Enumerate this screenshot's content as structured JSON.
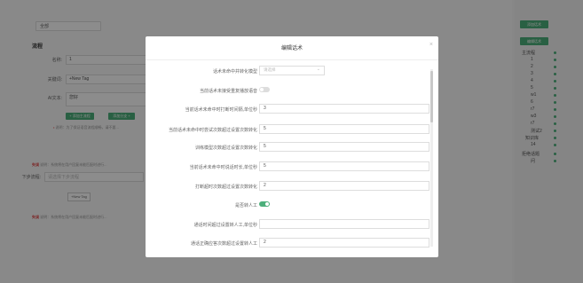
{
  "background": {
    "top_select": "全部",
    "section_flow": "流程",
    "fields": [
      {
        "label": "名称:",
        "value": "1"
      },
      {
        "label": "关键词:",
        "value": "+New Tag"
      },
      {
        "label": "AI文本:",
        "value": "您好"
      }
    ],
    "btn_add_main": "+ 添加主流程",
    "btn_add_branch": "添加分支 +",
    "note1_prefix": "• ",
    "note1": "说明：为了保证语音流程顺畅，请不要...",
    "section_hint": "失误",
    "hint_text": "说明：系统将在用户回复未能匹配时进行...",
    "next_label": "下步流程:",
    "next_placeholder": "请选择下步流程",
    "tag_new": "+New Tag",
    "section_hint2": "失误",
    "hint_text2": "说明：系统将在用户回复未能匹配时进行..."
  },
  "right_panel": {
    "btn_add": "添加话术",
    "btn_edit": "编辑话术",
    "tree": [
      "主流程",
      "1",
      "2",
      "3",
      "4",
      "5",
      "w1",
      "6",
      "r7",
      "w3",
      "r7",
      "测试2",
      "知识库",
      "14",
      "拒绝话题",
      "问"
    ]
  },
  "modal": {
    "title": "编辑话术",
    "close": "×",
    "rows": [
      {
        "label": "话术未命中并转化模型",
        "type": "select",
        "placeholder": "请选择"
      },
      {
        "label": "当前话术未接受重复播放语音",
        "type": "toggle",
        "on": false
      },
      {
        "label": "当前话术未命中时打断时间隔,单位秒",
        "type": "input",
        "value": "3"
      },
      {
        "label": "当前话术未命中时尝试次数超过设置次数转化",
        "type": "input",
        "value": "5"
      },
      {
        "label": "训练模型次数超过设置次数转化",
        "type": "input",
        "value": "5"
      },
      {
        "label": "当前话术未命中时说话时长,单位秒",
        "type": "input",
        "value": "5"
      },
      {
        "label": "打断超时次数超过设置次数转化",
        "type": "input",
        "value": "2"
      },
      {
        "label": "是否转人工",
        "type": "toggle",
        "on": true
      },
      {
        "label": "通话时间超过设置转人工,单位秒",
        "type": "input",
        "value": ""
      },
      {
        "label": "通话正确应答次数超过设置转人工",
        "type": "input",
        "value": "2"
      }
    ]
  },
  "colors": {
    "accent": "#4caf7a",
    "overlay": "rgba(0,0,0,0.45)"
  }
}
